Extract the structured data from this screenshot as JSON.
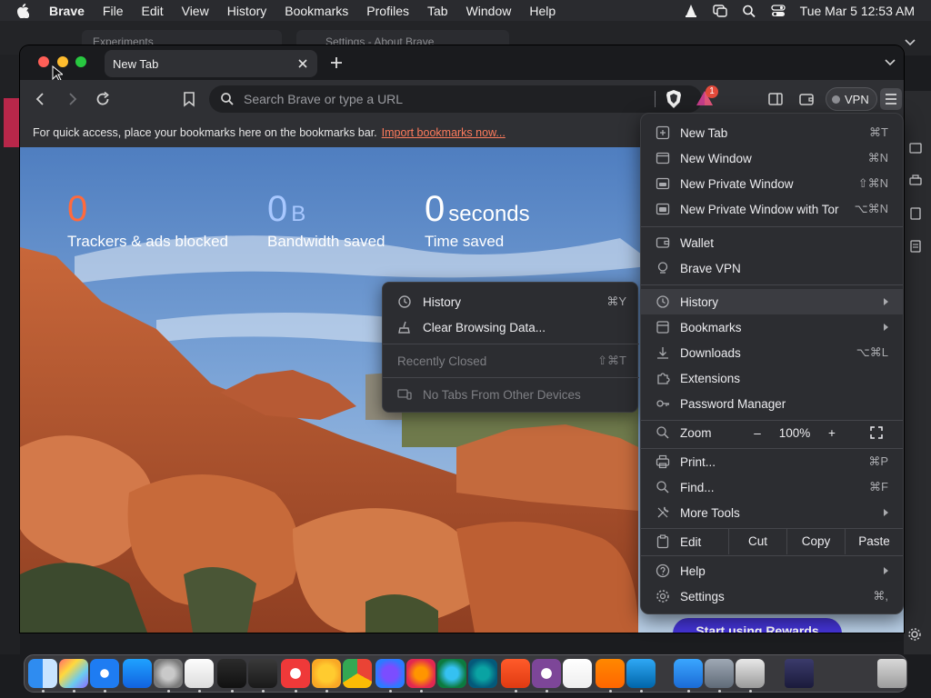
{
  "menubar": {
    "app": "Brave",
    "items": [
      "File",
      "Edit",
      "View",
      "History",
      "Bookmarks",
      "Profiles",
      "Tab",
      "Window",
      "Help"
    ],
    "clock": "Tue Mar 5  12:53 AM"
  },
  "background": {
    "tab1": "Experiments",
    "tab2": "Settings - About Brave"
  },
  "tab": {
    "title": "New Tab"
  },
  "urlbar": {
    "placeholder": "Search Brave or type a URL"
  },
  "toolbar": {
    "vpn_label": "VPN",
    "notification_count": "1"
  },
  "bookmarks_bar": {
    "text": "For quick access, place your bookmarks here on the bookmarks bar.",
    "link": "Import bookmarks now..."
  },
  "stats": {
    "trackers": {
      "value": "0",
      "label": "Trackers & ads blocked"
    },
    "bandwidth": {
      "value": "0",
      "unit": "B",
      "label": "Bandwidth saved"
    },
    "time": {
      "value": "0",
      "unit": "seconds",
      "label": "Time saved"
    }
  },
  "rewards_button": "Start using Rewards",
  "history_submenu": {
    "history": {
      "label": "History",
      "shortcut": "⌘Y"
    },
    "clear": {
      "label": "Clear Browsing Data..."
    },
    "recently_closed": {
      "label": "Recently Closed",
      "shortcut": "⇧⌘T"
    },
    "no_tabs": {
      "label": "No Tabs From Other Devices"
    }
  },
  "main_menu": {
    "new_tab": {
      "label": "New Tab",
      "shortcut": "⌘T"
    },
    "new_window": {
      "label": "New Window",
      "shortcut": "⌘N"
    },
    "new_private": {
      "label": "New Private Window",
      "shortcut": "⇧⌘N"
    },
    "new_private_tor": {
      "label": "New Private Window with Tor",
      "shortcut": "⌥⌘N"
    },
    "wallet": {
      "label": "Wallet"
    },
    "brave_vpn": {
      "label": "Brave VPN"
    },
    "history": {
      "label": "History"
    },
    "bookmarks": {
      "label": "Bookmarks"
    },
    "downloads": {
      "label": "Downloads",
      "shortcut": "⌥⌘L"
    },
    "extensions": {
      "label": "Extensions"
    },
    "password_manager": {
      "label": "Password Manager"
    },
    "zoom": {
      "label": "Zoom",
      "minus": "–",
      "value": "100%",
      "plus": "+"
    },
    "print": {
      "label": "Print...",
      "shortcut": "⌘P"
    },
    "find": {
      "label": "Find...",
      "shortcut": "⌘F"
    },
    "more_tools": {
      "label": "More Tools"
    },
    "edit": {
      "label": "Edit",
      "cut": "Cut",
      "copy": "Copy",
      "paste": "Paste"
    },
    "help": {
      "label": "Help"
    },
    "settings": {
      "label": "Settings",
      "shortcut": "⌘,"
    }
  },
  "colors": {
    "accent_orange": "#ff7b5c",
    "rewards_purple": "#4434d6",
    "stat_orange": "#ff6a3d",
    "stat_blue": "#a8c8ff"
  },
  "dock": {
    "icons": [
      "finder-icon",
      "launchpad-icon",
      "safari-icon",
      "app-store-icon",
      "system-settings-icon",
      "textedit-icon",
      "terminal-icon",
      "garageband-icon",
      "vivaldi-icon",
      "chrome-canary-icon",
      "chrome-icon",
      "firefox-nightly-icon",
      "firefox-icon",
      "edge-icon",
      "edge-canary-icon",
      "brave-icon",
      "tor-browser-icon",
      "capcut-icon",
      "vlc-icon",
      "vscode-icon",
      "xcode-icon",
      "disk-utility-icon",
      "archive-utility-icon",
      "stacks-icon",
      "trash-icon"
    ]
  }
}
